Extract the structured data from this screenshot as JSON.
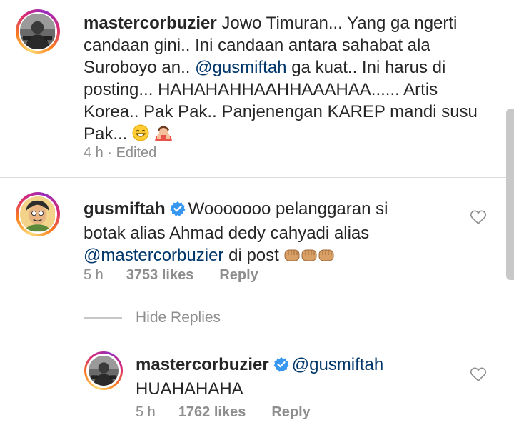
{
  "comments": [
    {
      "username": "mastercorbuzier",
      "text_parts": [
        "Jowo Timuran... Yang ga ngerti candaan gini.. Ini candaan antara sahabat ala Suroboyo an.. ",
        "@gusmiftah",
        " ga kuat.. Ini harus di posting... HAHAHAHHAAHHAAAHAA...... Artis Korea.. Pak Pak.. Panjenengan KAREP mandi susu Pak... "
      ],
      "time": "4 h",
      "edited": "Edited"
    },
    {
      "username": "gusmiftah",
      "text_before": "Wooooooo pelanggaran si botak alias Ahmad dedy cahyadi alias ",
      "mention": "@mastercorbuzier",
      "text_after": " di post ",
      "time": "5 h",
      "likes": "3753 likes",
      "reply": "Reply"
    }
  ],
  "hide_replies": "Hide Replies",
  "reply_comment": {
    "username": "mastercorbuzier",
    "mention": "@gusmiftah",
    "text": "HUAHAHAHA",
    "time": "5 h",
    "likes": "1762 likes",
    "reply": "Reply"
  },
  "colors": {
    "text": "#262626",
    "meta": "#8e8e8e",
    "mention": "#00376b",
    "verified": "#3897f0"
  },
  "icons": [
    "heart-icon",
    "verified-badge-icon",
    "grinning-emoji-icon",
    "face-palm-emoji-icon",
    "fist-emoji-icon"
  ]
}
